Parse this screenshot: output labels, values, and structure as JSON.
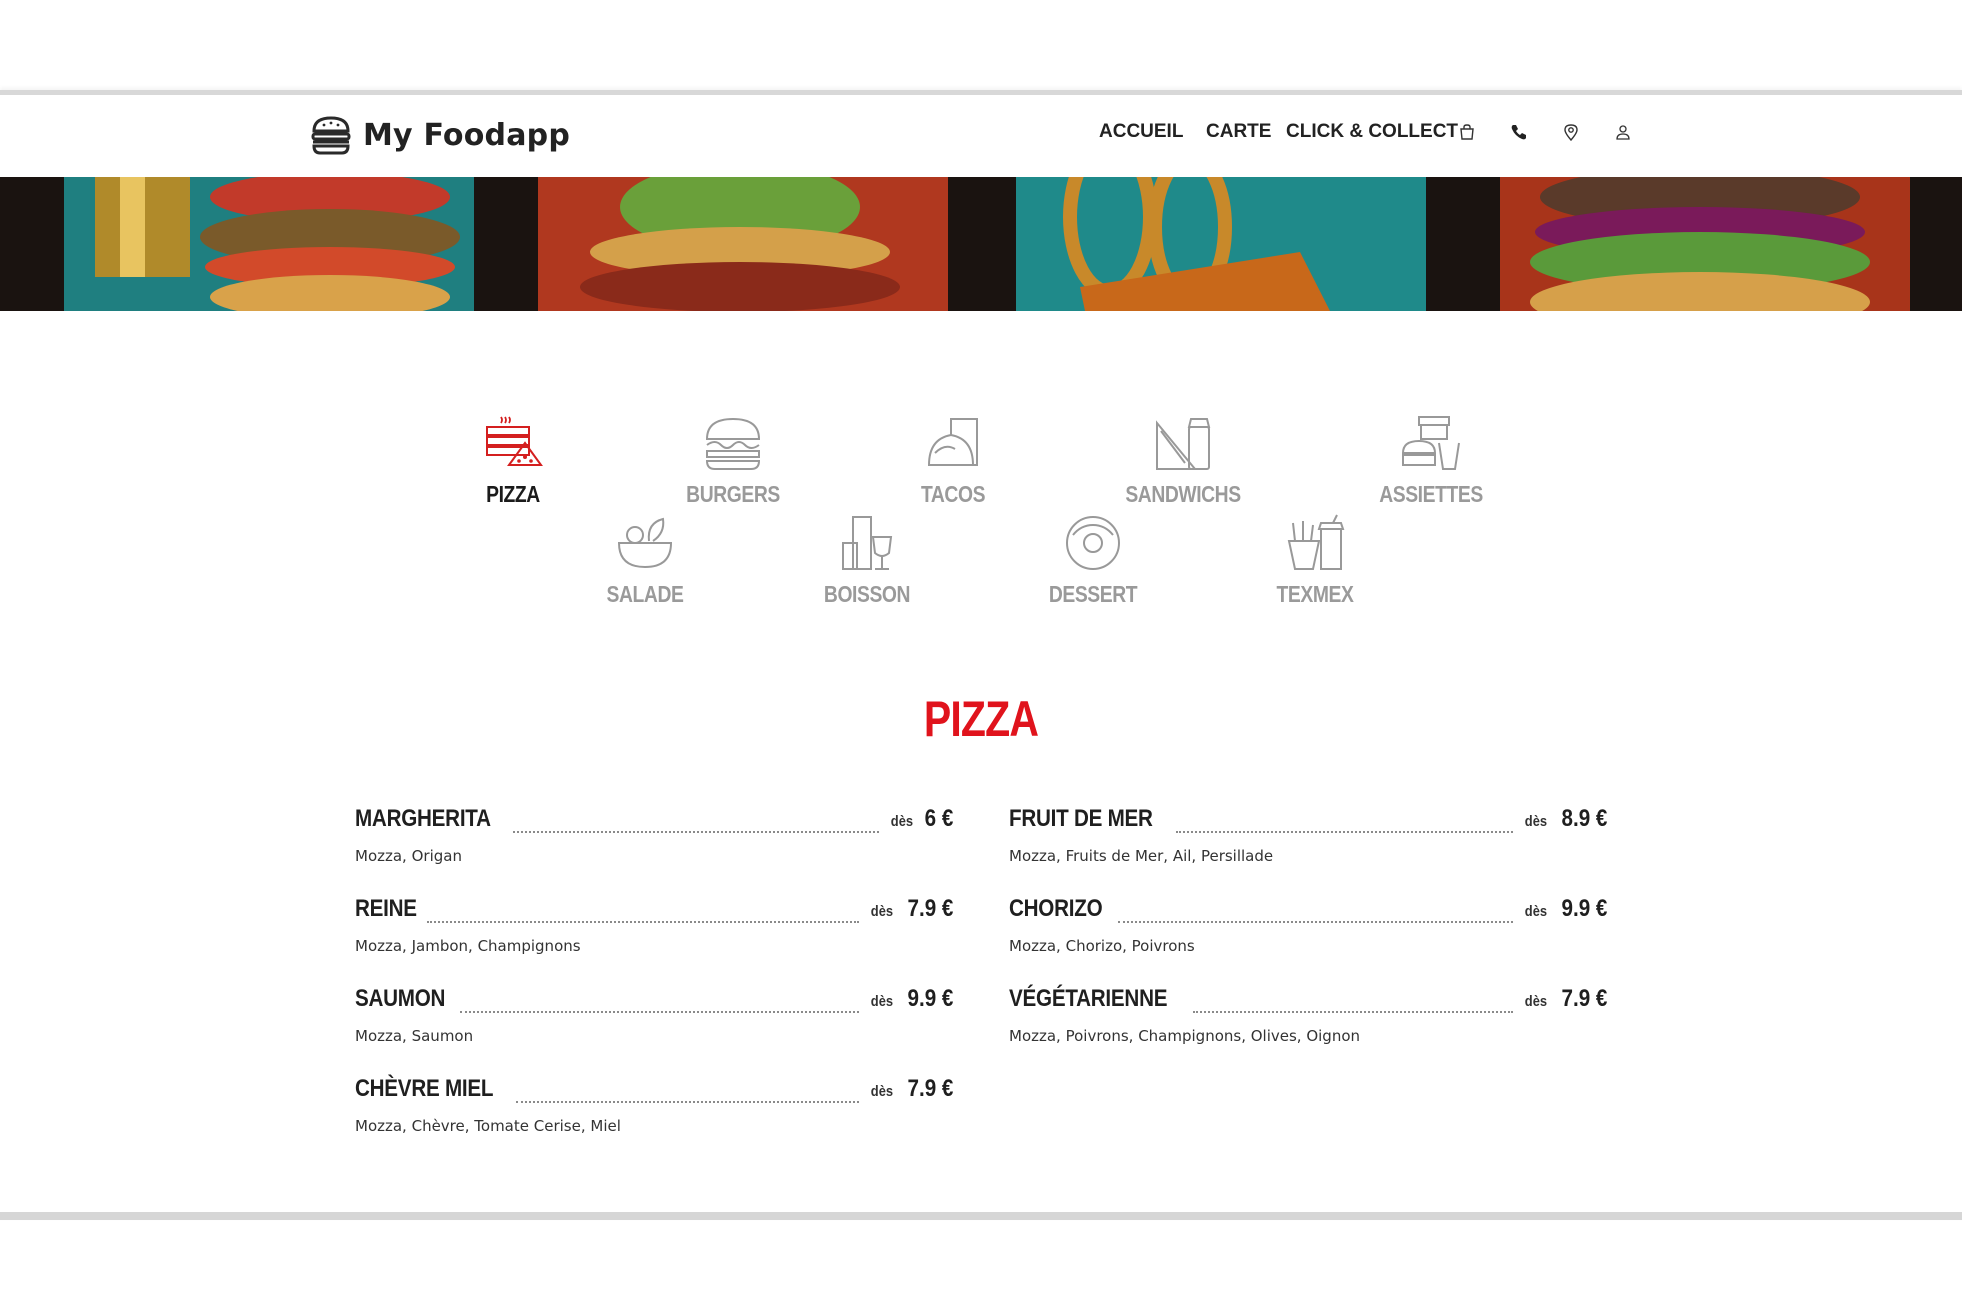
{
  "header": {
    "logo_text": "My Foodapp",
    "nav": [
      {
        "label": "ACCUEIL"
      },
      {
        "label": "CARTE"
      },
      {
        "label": "CLICK & COLLECT"
      }
    ],
    "icons": [
      "bag-icon",
      "phone-icon",
      "location-pin-icon",
      "user-icon"
    ]
  },
  "categories": [
    {
      "label": "PIZZA",
      "icon": "pizza-icon",
      "active": true
    },
    {
      "label": "BURGERS",
      "icon": "burger-icon",
      "active": false
    },
    {
      "label": "TACOS",
      "icon": "taco-icon",
      "active": false
    },
    {
      "label": "SANDWICHS",
      "icon": "sandwich-icon",
      "active": false
    },
    {
      "label": "ASSIETTES",
      "icon": "combo-plate-icon",
      "active": false
    },
    {
      "label": "SALADE",
      "icon": "salad-icon",
      "active": false
    },
    {
      "label": "BOISSON",
      "icon": "drinks-icon",
      "active": false
    },
    {
      "label": "DESSERT",
      "icon": "donut-icon",
      "active": false
    },
    {
      "label": "TEXMEX",
      "icon": "fries-drink-icon",
      "active": false
    }
  ],
  "section": {
    "title": "PIZZA"
  },
  "menu": {
    "price_prefix": "dès",
    "left": [
      {
        "name": "MARGHERITA",
        "price": "6 €",
        "desc": "Mozza, Origan"
      },
      {
        "name": "REINE",
        "price": "7.9 €",
        "desc": "Mozza, Jambon, Champignons"
      },
      {
        "name": "SAUMON",
        "price": "9.9 €",
        "desc": "Mozza, Saumon"
      },
      {
        "name": "CHÈVRE MIEL",
        "price": "7.9 €",
        "desc": "Mozza, Chèvre, Tomate Cerise, Miel"
      }
    ],
    "right": [
      {
        "name": "FRUIT DE MER",
        "price": "8.9 €",
        "desc": "Mozza, Fruits de Mer, Ail, Persillade"
      },
      {
        "name": "CHORIZO",
        "price": "9.9 €",
        "desc": "Mozza, Chorizo, Poivrons"
      },
      {
        "name": "VÉGÉTARIENNE",
        "price": "7.9 €",
        "desc": "Mozza, Poivrons, Champignons, Olives, Oignon"
      }
    ]
  },
  "colors": {
    "accent": "#e0131c",
    "inactive": "#9a9a9a",
    "text": "#1f1f1f"
  }
}
